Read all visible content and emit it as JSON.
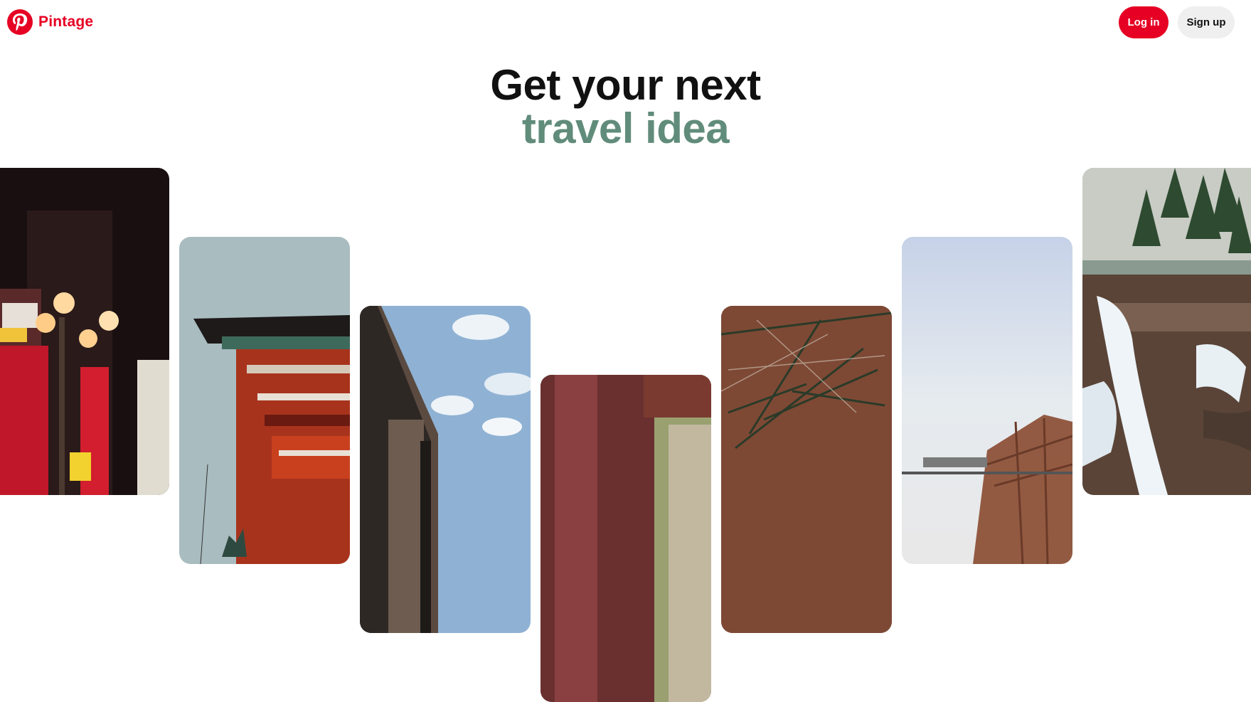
{
  "header": {
    "brand_name": "Pintage",
    "login_label": "Log in",
    "signup_label": "Sign up"
  },
  "hero": {
    "line1": "Get your next",
    "line2": "travel idea"
  },
  "colors": {
    "brand": "#e60023",
    "accent_text": "#618c7b",
    "secondary_button": "#efefef"
  },
  "gallery": {
    "images": [
      {
        "icon": "city-night-street-image"
      },
      {
        "icon": "shrine-gate-image"
      },
      {
        "icon": "building-sky-image"
      },
      {
        "icon": "temple-interior-image"
      },
      {
        "icon": "pine-branches-image"
      },
      {
        "icon": "structure-sky-image"
      },
      {
        "icon": "frozen-waterfall-image"
      }
    ]
  }
}
